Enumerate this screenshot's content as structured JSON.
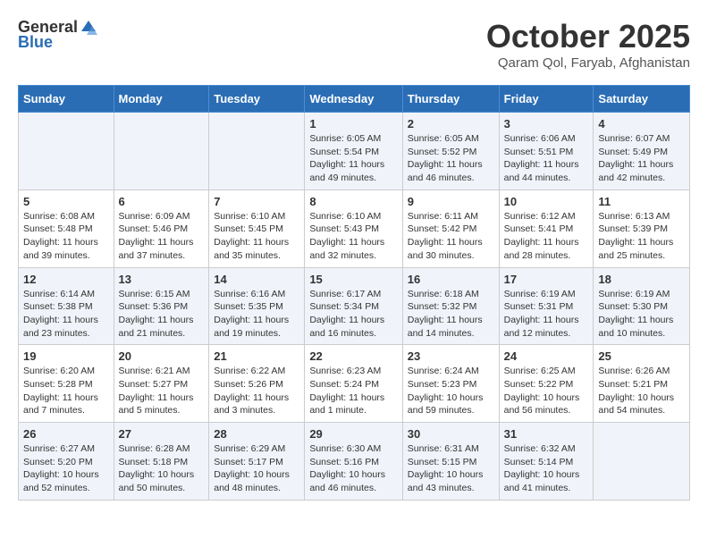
{
  "header": {
    "logo_general": "General",
    "logo_blue": "Blue",
    "month": "October 2025",
    "location": "Qaram Qol, Faryab, Afghanistan"
  },
  "weekdays": [
    "Sunday",
    "Monday",
    "Tuesday",
    "Wednesday",
    "Thursday",
    "Friday",
    "Saturday"
  ],
  "weeks": [
    [
      {
        "day": "",
        "info": ""
      },
      {
        "day": "",
        "info": ""
      },
      {
        "day": "",
        "info": ""
      },
      {
        "day": "1",
        "info": "Sunrise: 6:05 AM\nSunset: 5:54 PM\nDaylight: 11 hours\nand 49 minutes."
      },
      {
        "day": "2",
        "info": "Sunrise: 6:05 AM\nSunset: 5:52 PM\nDaylight: 11 hours\nand 46 minutes."
      },
      {
        "day": "3",
        "info": "Sunrise: 6:06 AM\nSunset: 5:51 PM\nDaylight: 11 hours\nand 44 minutes."
      },
      {
        "day": "4",
        "info": "Sunrise: 6:07 AM\nSunset: 5:49 PM\nDaylight: 11 hours\nand 42 minutes."
      }
    ],
    [
      {
        "day": "5",
        "info": "Sunrise: 6:08 AM\nSunset: 5:48 PM\nDaylight: 11 hours\nand 39 minutes."
      },
      {
        "day": "6",
        "info": "Sunrise: 6:09 AM\nSunset: 5:46 PM\nDaylight: 11 hours\nand 37 minutes."
      },
      {
        "day": "7",
        "info": "Sunrise: 6:10 AM\nSunset: 5:45 PM\nDaylight: 11 hours\nand 35 minutes."
      },
      {
        "day": "8",
        "info": "Sunrise: 6:10 AM\nSunset: 5:43 PM\nDaylight: 11 hours\nand 32 minutes."
      },
      {
        "day": "9",
        "info": "Sunrise: 6:11 AM\nSunset: 5:42 PM\nDaylight: 11 hours\nand 30 minutes."
      },
      {
        "day": "10",
        "info": "Sunrise: 6:12 AM\nSunset: 5:41 PM\nDaylight: 11 hours\nand 28 minutes."
      },
      {
        "day": "11",
        "info": "Sunrise: 6:13 AM\nSunset: 5:39 PM\nDaylight: 11 hours\nand 25 minutes."
      }
    ],
    [
      {
        "day": "12",
        "info": "Sunrise: 6:14 AM\nSunset: 5:38 PM\nDaylight: 11 hours\nand 23 minutes."
      },
      {
        "day": "13",
        "info": "Sunrise: 6:15 AM\nSunset: 5:36 PM\nDaylight: 11 hours\nand 21 minutes."
      },
      {
        "day": "14",
        "info": "Sunrise: 6:16 AM\nSunset: 5:35 PM\nDaylight: 11 hours\nand 19 minutes."
      },
      {
        "day": "15",
        "info": "Sunrise: 6:17 AM\nSunset: 5:34 PM\nDaylight: 11 hours\nand 16 minutes."
      },
      {
        "day": "16",
        "info": "Sunrise: 6:18 AM\nSunset: 5:32 PM\nDaylight: 11 hours\nand 14 minutes."
      },
      {
        "day": "17",
        "info": "Sunrise: 6:19 AM\nSunset: 5:31 PM\nDaylight: 11 hours\nand 12 minutes."
      },
      {
        "day": "18",
        "info": "Sunrise: 6:19 AM\nSunset: 5:30 PM\nDaylight: 11 hours\nand 10 minutes."
      }
    ],
    [
      {
        "day": "19",
        "info": "Sunrise: 6:20 AM\nSunset: 5:28 PM\nDaylight: 11 hours\nand 7 minutes."
      },
      {
        "day": "20",
        "info": "Sunrise: 6:21 AM\nSunset: 5:27 PM\nDaylight: 11 hours\nand 5 minutes."
      },
      {
        "day": "21",
        "info": "Sunrise: 6:22 AM\nSunset: 5:26 PM\nDaylight: 11 hours\nand 3 minutes."
      },
      {
        "day": "22",
        "info": "Sunrise: 6:23 AM\nSunset: 5:24 PM\nDaylight: 11 hours\nand 1 minute."
      },
      {
        "day": "23",
        "info": "Sunrise: 6:24 AM\nSunset: 5:23 PM\nDaylight: 10 hours\nand 59 minutes."
      },
      {
        "day": "24",
        "info": "Sunrise: 6:25 AM\nSunset: 5:22 PM\nDaylight: 10 hours\nand 56 minutes."
      },
      {
        "day": "25",
        "info": "Sunrise: 6:26 AM\nSunset: 5:21 PM\nDaylight: 10 hours\nand 54 minutes."
      }
    ],
    [
      {
        "day": "26",
        "info": "Sunrise: 6:27 AM\nSunset: 5:20 PM\nDaylight: 10 hours\nand 52 minutes."
      },
      {
        "day": "27",
        "info": "Sunrise: 6:28 AM\nSunset: 5:18 PM\nDaylight: 10 hours\nand 50 minutes."
      },
      {
        "day": "28",
        "info": "Sunrise: 6:29 AM\nSunset: 5:17 PM\nDaylight: 10 hours\nand 48 minutes."
      },
      {
        "day": "29",
        "info": "Sunrise: 6:30 AM\nSunset: 5:16 PM\nDaylight: 10 hours\nand 46 minutes."
      },
      {
        "day": "30",
        "info": "Sunrise: 6:31 AM\nSunset: 5:15 PM\nDaylight: 10 hours\nand 43 minutes."
      },
      {
        "day": "31",
        "info": "Sunrise: 6:32 AM\nSunset: 5:14 PM\nDaylight: 10 hours\nand 41 minutes."
      },
      {
        "day": "",
        "info": ""
      }
    ]
  ]
}
